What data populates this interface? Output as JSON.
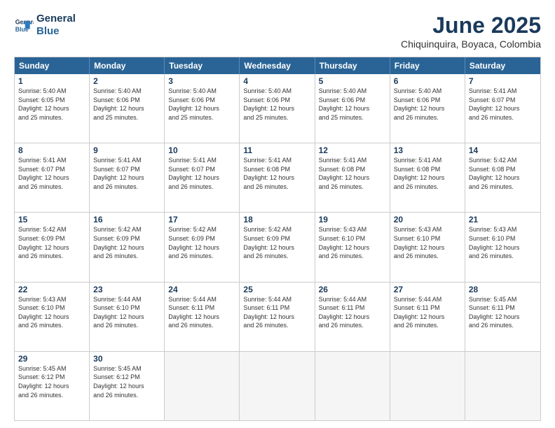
{
  "logo": {
    "line1": "General",
    "line2": "Blue"
  },
  "title": "June 2025",
  "location": "Chiquinquira, Boyaca, Colombia",
  "weekdays": [
    "Sunday",
    "Monday",
    "Tuesday",
    "Wednesday",
    "Thursday",
    "Friday",
    "Saturday"
  ],
  "rows": [
    [
      {
        "day": "1",
        "lines": [
          "Sunrise: 5:40 AM",
          "Sunset: 6:05 PM",
          "Daylight: 12 hours",
          "and 25 minutes."
        ]
      },
      {
        "day": "2",
        "lines": [
          "Sunrise: 5:40 AM",
          "Sunset: 6:06 PM",
          "Daylight: 12 hours",
          "and 25 minutes."
        ]
      },
      {
        "day": "3",
        "lines": [
          "Sunrise: 5:40 AM",
          "Sunset: 6:06 PM",
          "Daylight: 12 hours",
          "and 25 minutes."
        ]
      },
      {
        "day": "4",
        "lines": [
          "Sunrise: 5:40 AM",
          "Sunset: 6:06 PM",
          "Daylight: 12 hours",
          "and 25 minutes."
        ]
      },
      {
        "day": "5",
        "lines": [
          "Sunrise: 5:40 AM",
          "Sunset: 6:06 PM",
          "Daylight: 12 hours",
          "and 25 minutes."
        ]
      },
      {
        "day": "6",
        "lines": [
          "Sunrise: 5:40 AM",
          "Sunset: 6:06 PM",
          "Daylight: 12 hours",
          "and 26 minutes."
        ]
      },
      {
        "day": "7",
        "lines": [
          "Sunrise: 5:41 AM",
          "Sunset: 6:07 PM",
          "Daylight: 12 hours",
          "and 26 minutes."
        ]
      }
    ],
    [
      {
        "day": "8",
        "lines": [
          "Sunrise: 5:41 AM",
          "Sunset: 6:07 PM",
          "Daylight: 12 hours",
          "and 26 minutes."
        ]
      },
      {
        "day": "9",
        "lines": [
          "Sunrise: 5:41 AM",
          "Sunset: 6:07 PM",
          "Daylight: 12 hours",
          "and 26 minutes."
        ]
      },
      {
        "day": "10",
        "lines": [
          "Sunrise: 5:41 AM",
          "Sunset: 6:07 PM",
          "Daylight: 12 hours",
          "and 26 minutes."
        ]
      },
      {
        "day": "11",
        "lines": [
          "Sunrise: 5:41 AM",
          "Sunset: 6:08 PM",
          "Daylight: 12 hours",
          "and 26 minutes."
        ]
      },
      {
        "day": "12",
        "lines": [
          "Sunrise: 5:41 AM",
          "Sunset: 6:08 PM",
          "Daylight: 12 hours",
          "and 26 minutes."
        ]
      },
      {
        "day": "13",
        "lines": [
          "Sunrise: 5:41 AM",
          "Sunset: 6:08 PM",
          "Daylight: 12 hours",
          "and 26 minutes."
        ]
      },
      {
        "day": "14",
        "lines": [
          "Sunrise: 5:42 AM",
          "Sunset: 6:08 PM",
          "Daylight: 12 hours",
          "and 26 minutes."
        ]
      }
    ],
    [
      {
        "day": "15",
        "lines": [
          "Sunrise: 5:42 AM",
          "Sunset: 6:09 PM",
          "Daylight: 12 hours",
          "and 26 minutes."
        ]
      },
      {
        "day": "16",
        "lines": [
          "Sunrise: 5:42 AM",
          "Sunset: 6:09 PM",
          "Daylight: 12 hours",
          "and 26 minutes."
        ]
      },
      {
        "day": "17",
        "lines": [
          "Sunrise: 5:42 AM",
          "Sunset: 6:09 PM",
          "Daylight: 12 hours",
          "and 26 minutes."
        ]
      },
      {
        "day": "18",
        "lines": [
          "Sunrise: 5:42 AM",
          "Sunset: 6:09 PM",
          "Daylight: 12 hours",
          "and 26 minutes."
        ]
      },
      {
        "day": "19",
        "lines": [
          "Sunrise: 5:43 AM",
          "Sunset: 6:10 PM",
          "Daylight: 12 hours",
          "and 26 minutes."
        ]
      },
      {
        "day": "20",
        "lines": [
          "Sunrise: 5:43 AM",
          "Sunset: 6:10 PM",
          "Daylight: 12 hours",
          "and 26 minutes."
        ]
      },
      {
        "day": "21",
        "lines": [
          "Sunrise: 5:43 AM",
          "Sunset: 6:10 PM",
          "Daylight: 12 hours",
          "and 26 minutes."
        ]
      }
    ],
    [
      {
        "day": "22",
        "lines": [
          "Sunrise: 5:43 AM",
          "Sunset: 6:10 PM",
          "Daylight: 12 hours",
          "and 26 minutes."
        ]
      },
      {
        "day": "23",
        "lines": [
          "Sunrise: 5:44 AM",
          "Sunset: 6:10 PM",
          "Daylight: 12 hours",
          "and 26 minutes."
        ]
      },
      {
        "day": "24",
        "lines": [
          "Sunrise: 5:44 AM",
          "Sunset: 6:11 PM",
          "Daylight: 12 hours",
          "and 26 minutes."
        ]
      },
      {
        "day": "25",
        "lines": [
          "Sunrise: 5:44 AM",
          "Sunset: 6:11 PM",
          "Daylight: 12 hours",
          "and 26 minutes."
        ]
      },
      {
        "day": "26",
        "lines": [
          "Sunrise: 5:44 AM",
          "Sunset: 6:11 PM",
          "Daylight: 12 hours",
          "and 26 minutes."
        ]
      },
      {
        "day": "27",
        "lines": [
          "Sunrise: 5:44 AM",
          "Sunset: 6:11 PM",
          "Daylight: 12 hours",
          "and 26 minutes."
        ]
      },
      {
        "day": "28",
        "lines": [
          "Sunrise: 5:45 AM",
          "Sunset: 6:11 PM",
          "Daylight: 12 hours",
          "and 26 minutes."
        ]
      }
    ],
    [
      {
        "day": "29",
        "lines": [
          "Sunrise: 5:45 AM",
          "Sunset: 6:12 PM",
          "Daylight: 12 hours",
          "and 26 minutes."
        ]
      },
      {
        "day": "30",
        "lines": [
          "Sunrise: 5:45 AM",
          "Sunset: 6:12 PM",
          "Daylight: 12 hours",
          "and 26 minutes."
        ]
      },
      {
        "day": "",
        "lines": []
      },
      {
        "day": "",
        "lines": []
      },
      {
        "day": "",
        "lines": []
      },
      {
        "day": "",
        "lines": []
      },
      {
        "day": "",
        "lines": []
      }
    ]
  ]
}
